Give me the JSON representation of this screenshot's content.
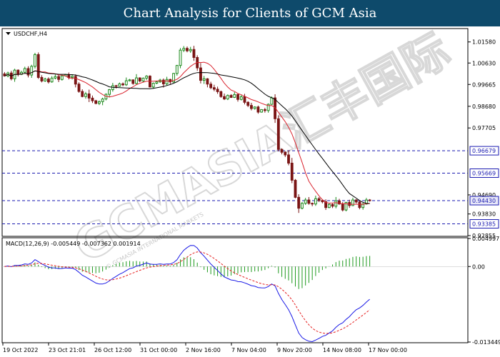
{
  "header": {
    "title": "Chart Analysis for Clients of GCM Asia"
  },
  "watermark": {
    "text": "GCMASIA汇丰国际",
    "sub": "© GCMASIA INTERNATIONAL MARKETS"
  },
  "chart_data": {
    "type": "candlestick",
    "symbol": "USDCHF,H4",
    "timeframe": "H4",
    "price_axis": {
      "range": [
        0.92855,
        1.0215
      ],
      "ticks": [
        "1.01580",
        "1.00630",
        "0.99665",
        "0.98680",
        "0.97705",
        "0.96679",
        "0.95669",
        "0.94690",
        "0.94430",
        "0.93830",
        "0.93385",
        "0.92855"
      ]
    },
    "time_axis": {
      "labels": [
        "19 Oct 2022",
        "23 Oct 21:01",
        "26 Oct 12:00",
        "31 Oct 00:00",
        "2 Nov 16:00",
        "7 Nov 04:00",
        "9 Nov 20:00",
        "14 Nov 08:00",
        "17 Nov 00:00"
      ]
    },
    "levels": [
      {
        "name": "resistance-1",
        "value": 0.96679,
        "label": "0.96679"
      },
      {
        "name": "resistance-2",
        "value": 0.95669,
        "label": "0.95669"
      },
      {
        "name": "support-1",
        "value": 0.9443,
        "label": "0.94430"
      },
      {
        "name": "support-2",
        "value": 0.93385,
        "label": "0.93385"
      }
    ],
    "current_price": {
      "value": 0.9443,
      "label": "0.94430"
    },
    "close_series": [
      1.0005,
      1.0018,
      0.9992,
      1.0031,
      1.0012,
      1.0021,
      1.0038,
      1.0009,
      1.0048,
      1.0101,
      0.9998,
      0.9982,
      0.9991,
      0.9978,
      0.9995,
      1.0002,
      0.9989,
      1.0005,
      1.0011,
      0.9998,
      1.0003,
      0.9968,
      0.9935,
      0.9912,
      0.9924,
      0.9905,
      0.9893,
      0.9881,
      0.9889,
      0.9901,
      0.9922,
      0.9943,
      0.9961,
      0.9958,
      0.9969,
      0.9965,
      0.9983,
      0.9987,
      0.9971,
      0.9996,
      0.9982,
      0.9995,
      1.0004,
      0.9955,
      0.9972,
      0.9978,
      0.9986,
      0.9969,
      0.9989,
      0.9978,
      1.0016,
      1.0052,
      1.0121,
      1.0129,
      1.0118,
      1.0124,
      1.0088,
      1.0041,
      0.9985,
      0.9992,
      0.9968,
      0.9952,
      0.9945,
      0.9934,
      0.9912,
      0.9901,
      0.9917,
      0.9908,
      0.9921,
      0.9899,
      0.9911,
      0.9886,
      0.9872,
      0.9858,
      0.9865,
      0.9842,
      0.9853,
      0.9849,
      0.9877,
      0.9906,
      0.9812,
      0.9674,
      0.9661,
      0.9649,
      0.9612,
      0.9535,
      0.9458,
      0.9409,
      0.9431,
      0.9446,
      0.9431,
      0.9428,
      0.9452,
      0.9444,
      0.9438,
      0.9412,
      0.9426,
      0.9418,
      0.9442,
      0.9428,
      0.9401,
      0.9435,
      0.9421,
      0.9446,
      0.9437,
      0.9412,
      0.9428,
      0.9446,
      0.9443
    ],
    "moving_averages": [
      {
        "name": "fast-ma",
        "color": "#d9232e"
      },
      {
        "name": "slow-ma",
        "color": "#000000"
      }
    ],
    "macd": {
      "label": "MACD(12,26,9) -0.005449 -0.007362 0.001914",
      "params": [
        12,
        26,
        9
      ],
      "macd": -0.005449,
      "signal": -0.007362,
      "histogram": 0.001914,
      "axis_range": [
        -0.013449,
        0.004997
      ],
      "ticks": [
        "0.004997",
        "0.00",
        "-0.013449"
      ]
    },
    "colors": {
      "bull": "#1e8a1e",
      "bear": "#7a1515",
      "level": "#1a1ab0",
      "macd_line": "#1a1ae6",
      "signal_line": "#e62020",
      "histogram": "#1e9a1e"
    }
  }
}
